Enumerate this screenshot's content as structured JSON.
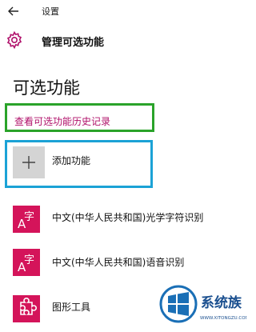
{
  "window": {
    "title": "设置",
    "back_icon": "back-arrow-icon"
  },
  "header": {
    "icon": "gear-icon",
    "title": "管理可选功能",
    "accent": "#b0106a"
  },
  "section": {
    "title": "可选功能"
  },
  "history_link": {
    "label": "查看可选功能历史记录",
    "color": "#b0106a"
  },
  "add_feature": {
    "label": "添加功能",
    "icon": "plus-icon"
  },
  "features": [
    {
      "label": "中文(中华人民共和国)光学字符识别",
      "icon": "language-char-icon",
      "glyph": "字"
    },
    {
      "label": "中文(中华人民共和国)语音识别",
      "icon": "language-char-icon",
      "glyph": "字"
    },
    {
      "label": "图形工具",
      "icon": "puzzle-piece-icon"
    }
  ],
  "annotation_colors": {
    "green_box": "#2aa32a",
    "blue_box": "#1ba2d6",
    "tile": "#d4145a"
  },
  "watermark": {
    "brand": "系统族",
    "site": "WWW.XITONGZU.COM"
  }
}
